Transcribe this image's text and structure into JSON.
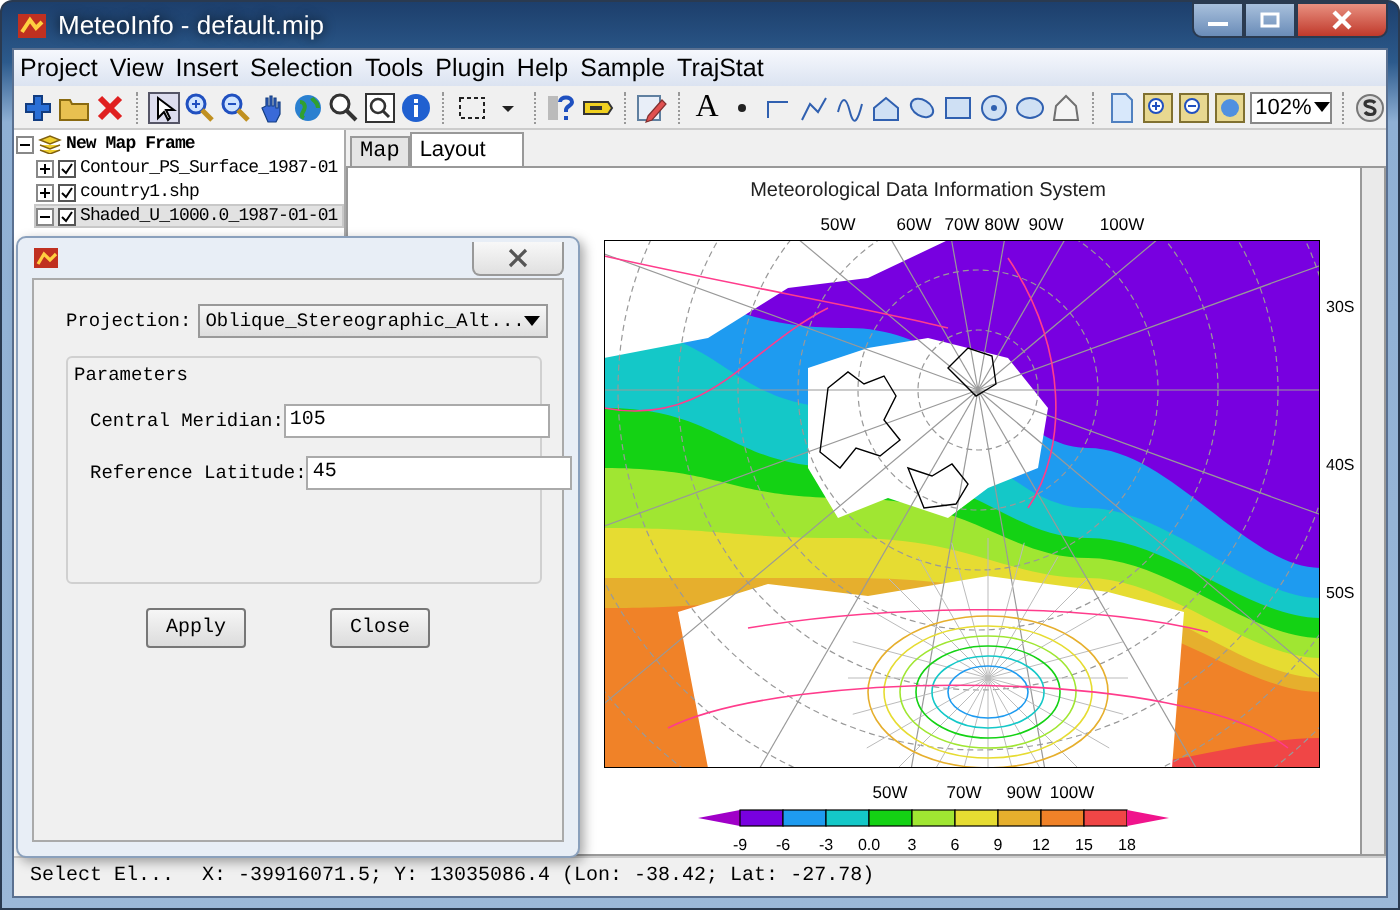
{
  "window": {
    "title": "MeteoInfo - default.mip"
  },
  "menu": [
    "Project",
    "View",
    "Insert",
    "Selection",
    "Tools",
    "Plugin",
    "Help",
    "Sample",
    "TrajStat"
  ],
  "toolbar": {
    "text_tool": "A",
    "zoom": "102%"
  },
  "layers_panel": {
    "root": {
      "label": "New Map Frame",
      "expanded": true,
      "children": [
        {
          "label": "Contour_PS_Surface_1987-01",
          "checked": true,
          "expanded": false,
          "selected": false
        },
        {
          "label": "country1.shp",
          "checked": true,
          "expanded": false,
          "selected": false
        },
        {
          "label": "Shaded_U_1000.0_1987-01-01",
          "checked": true,
          "expanded": true,
          "selected": true
        }
      ]
    }
  },
  "tabs": [
    {
      "label": "Map",
      "selected": false
    },
    {
      "label": "Layout",
      "selected": true
    }
  ],
  "layout": {
    "title": "Meteorological Data Information System",
    "top_longitudes": [
      "50W",
      "60W",
      "70W",
      "80W",
      "90W",
      "100W"
    ],
    "right_latitudes": [
      "30S",
      "40S",
      "50S"
    ],
    "bottom_longitudes": [
      "50W",
      "70W",
      "90W",
      "100W"
    ],
    "colorbar": {
      "segments": [
        {
          "kind": "arrow-left",
          "color": "#a000c8"
        },
        {
          "kind": "box",
          "color": "#7800e0"
        },
        {
          "kind": "box",
          "color": "#1e9bf0"
        },
        {
          "kind": "box",
          "color": "#14c8c8"
        },
        {
          "kind": "box",
          "color": "#14d214"
        },
        {
          "kind": "box",
          "color": "#a0e632"
        },
        {
          "kind": "box",
          "color": "#e6dc32"
        },
        {
          "kind": "box",
          "color": "#e6af2d"
        },
        {
          "kind": "box",
          "color": "#f08228"
        },
        {
          "kind": "box",
          "color": "#f04646"
        },
        {
          "kind": "arrow-right",
          "color": "#f0148c"
        }
      ],
      "labels": [
        "-9",
        "-6",
        "-3",
        "0.0",
        "3",
        "6",
        "9",
        "12",
        "15",
        "18"
      ]
    }
  },
  "dialog": {
    "projection_label": "Projection:",
    "projection": "Oblique_Stereographic_Alt...",
    "group": "Parameters",
    "fields": [
      {
        "label": "Central Meridian:",
        "value": "105"
      },
      {
        "label": "Reference Latitude:",
        "value": "45"
      }
    ],
    "buttons": [
      "Apply",
      "Close"
    ]
  },
  "status_bar": {
    "message": "Select El...",
    "coordinates": "X: -39916071.5; Y: 13035086.4 (Lon: -38.42; Lat: -27.78)"
  }
}
